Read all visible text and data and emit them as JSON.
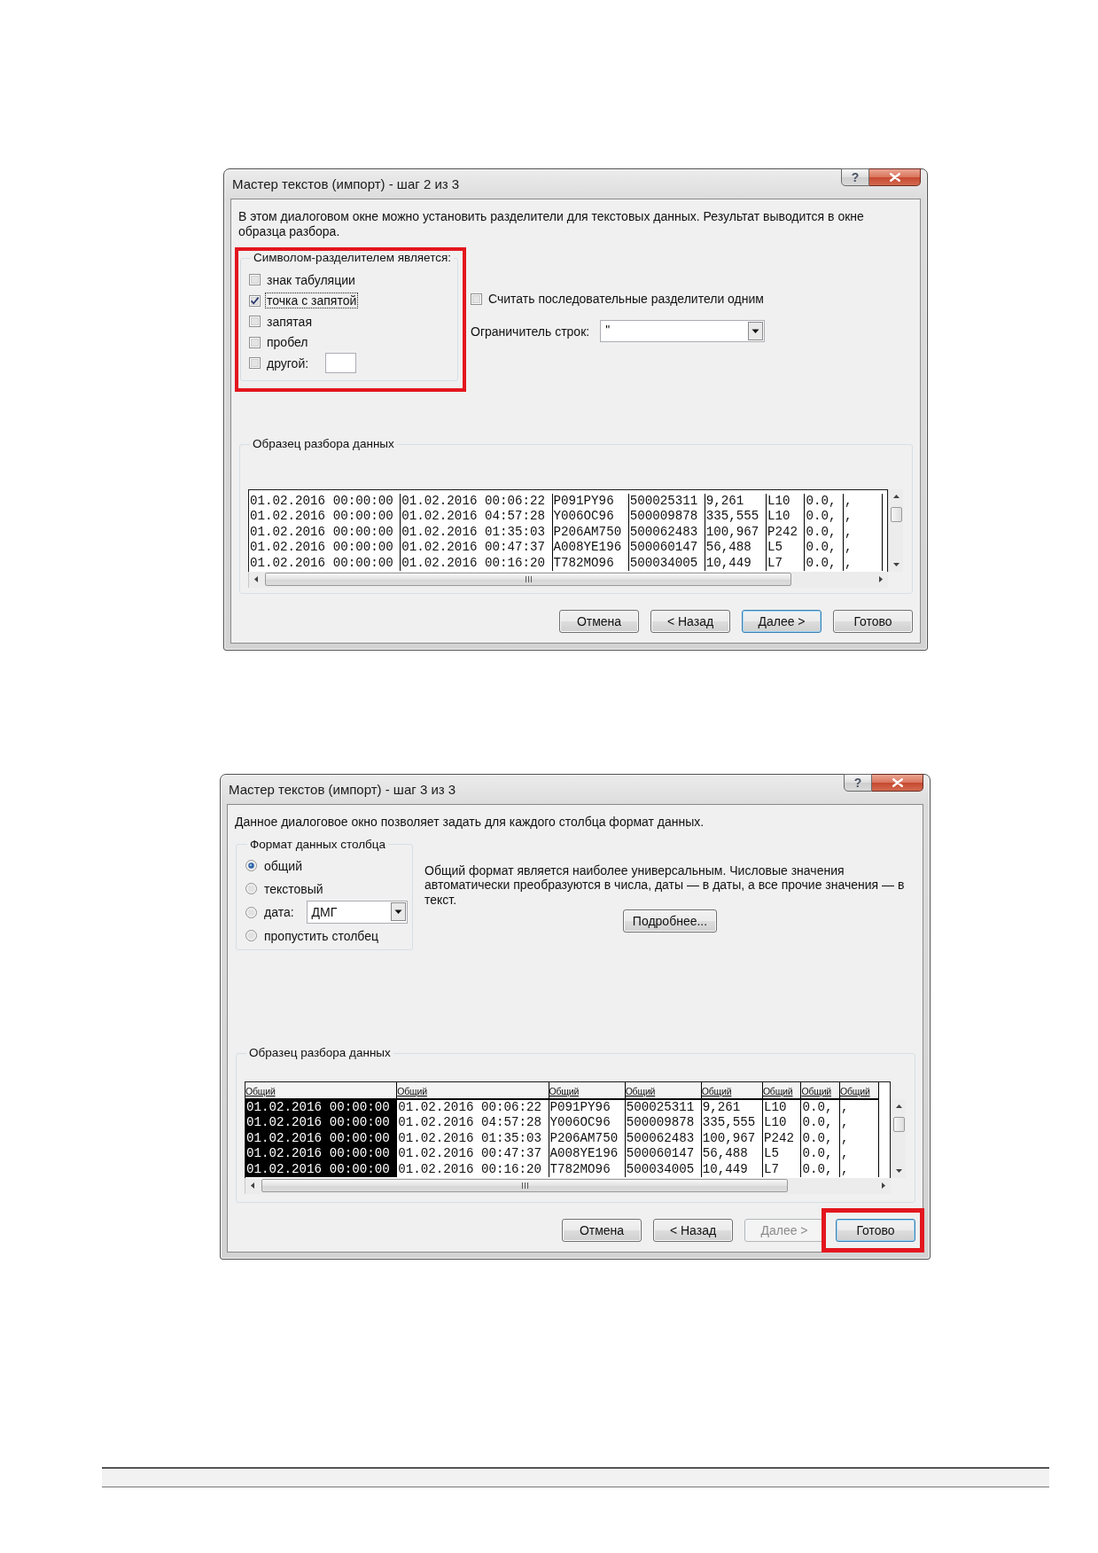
{
  "dialogs": [
    {
      "kind": "delimiters",
      "title": "Мастер текстов (импорт) - шаг 2 из 3",
      "help_button": "?",
      "description": "В этом диалоговом окне можно установить разделители для текстовых данных. Результат выводится в окне образца разбора.",
      "delimiter_group": {
        "title": "Символом-разделителем является:",
        "highlighted": true,
        "options": [
          {
            "kind": "checkbox",
            "label": "знак табуляции",
            "checked": false,
            "focused": false
          },
          {
            "kind": "checkbox",
            "label": "точка с запятой",
            "checked": true,
            "focused": true
          },
          {
            "kind": "checkbox",
            "label": "запятая",
            "checked": false,
            "focused": false
          },
          {
            "kind": "checkbox",
            "label": "пробел",
            "checked": false,
            "focused": false
          },
          {
            "kind": "checkbox_field",
            "label": "другой:",
            "checked": false,
            "focused": false
          }
        ]
      },
      "consecutive_option": {
        "label": "Считать последовательные разделители одним",
        "checked": false
      },
      "text_qualifier": {
        "label": "Ограничитель строк:",
        "value": "\""
      },
      "preview": {
        "title": "Образец разбора данных",
        "rows": [
          [
            "01.02.2016 00:00:00",
            "01.02.2016 00:06:22",
            "P091PY96",
            "500025311",
            "9,261",
            "L10",
            "0.0,",
            ","
          ],
          [
            "01.02.2016 00:00:00",
            "01.02.2016 04:57:28",
            "Y006OC96",
            "500009878",
            "335,555",
            "L10",
            "0.0,",
            ","
          ],
          [
            "01.02.2016 00:00:00",
            "01.02.2016 01:35:03",
            "P206AM750",
            "500062483",
            "100,967",
            "P242",
            "0.0,",
            ","
          ],
          [
            "01.02.2016 00:00:00",
            "01.02.2016 00:47:37",
            "A008YE196",
            "500060147",
            "56,488",
            "L5",
            "0.0,",
            ","
          ],
          [
            "01.02.2016 00:00:00",
            "01.02.2016 00:16:20",
            "T782MO96",
            "500034005",
            "10,449",
            "L7",
            "0.0,",
            ","
          ]
        ]
      },
      "buttons": [
        {
          "label": "Отмена",
          "default": false,
          "disabled": false,
          "highlighted": false
        },
        {
          "label": "< Назад",
          "default": false,
          "disabled": false,
          "highlighted": false
        },
        {
          "label": "Далее >",
          "default": true,
          "disabled": false,
          "highlighted": false
        },
        {
          "label": "Готово",
          "default": false,
          "disabled": false,
          "highlighted": false
        }
      ]
    },
    {
      "kind": "column_format",
      "title": "Мастер текстов (импорт) - шаг 3 из 3",
      "help_button": "?",
      "description": "Данное диалоговое окно позволяет задать для каждого столбца формат данных.",
      "format_group": {
        "title": "Формат данных столбца",
        "options": [
          {
            "kind": "radio",
            "label": "общий",
            "selected": true
          },
          {
            "kind": "radio",
            "label": "текстовый",
            "selected": false
          },
          {
            "kind": "radio_dropdown",
            "label": "дата:",
            "selected": false,
            "value": "ДМГ"
          },
          {
            "kind": "radio",
            "label": "пропустить столбец",
            "selected": false
          }
        ]
      },
      "format_hint": "Общий формат является наиболее универсальным. Числовые значения автоматически преобразуются в числа, даты — в даты, а все прочие значения — в текст.",
      "details_button": "Подробнее...",
      "preview": {
        "title": "Образец разбора данных",
        "columns": [
          {
            "header": "Общий",
            "selected": true
          },
          {
            "header": "Общий",
            "selected": false
          },
          {
            "header": "Общий",
            "selected": false
          },
          {
            "header": "Общий",
            "selected": false
          },
          {
            "header": "Общий",
            "selected": false
          },
          {
            "header": "Общий",
            "selected": false
          },
          {
            "header": "Общий",
            "selected": false
          },
          {
            "header": "Общий",
            "selected": false
          }
        ],
        "rows": [
          [
            "01.02.2016 00:00:00",
            "01.02.2016 00:06:22",
            "P091PY96",
            "500025311",
            "9,261",
            "L10",
            "0.0,",
            ","
          ],
          [
            "01.02.2016 00:00:00",
            "01.02.2016 04:57:28",
            "Y006OC96",
            "500009878",
            "335,555",
            "L10",
            "0.0,",
            ","
          ],
          [
            "01.02.2016 00:00:00",
            "01.02.2016 01:35:03",
            "P206AM750",
            "500062483",
            "100,967",
            "P242",
            "0.0,",
            ","
          ],
          [
            "01.02.2016 00:00:00",
            "01.02.2016 00:47:37",
            "A008YE196",
            "500060147",
            "56,488",
            "L5",
            "0.0,",
            ","
          ],
          [
            "01.02.2016 00:00:00",
            "01.02.2016 00:16:20",
            "T782MO96",
            "500034005",
            "10,449",
            "L7",
            "0.0,",
            ","
          ]
        ]
      },
      "buttons": [
        {
          "label": "Отмена",
          "default": false,
          "disabled": false,
          "highlighted": false
        },
        {
          "label": "< Назад",
          "default": false,
          "disabled": false,
          "highlighted": false
        },
        {
          "label": "Далее >",
          "default": false,
          "disabled": true,
          "highlighted": false
        },
        {
          "label": "Готово",
          "default": true,
          "disabled": false,
          "highlighted": true
        }
      ]
    }
  ]
}
